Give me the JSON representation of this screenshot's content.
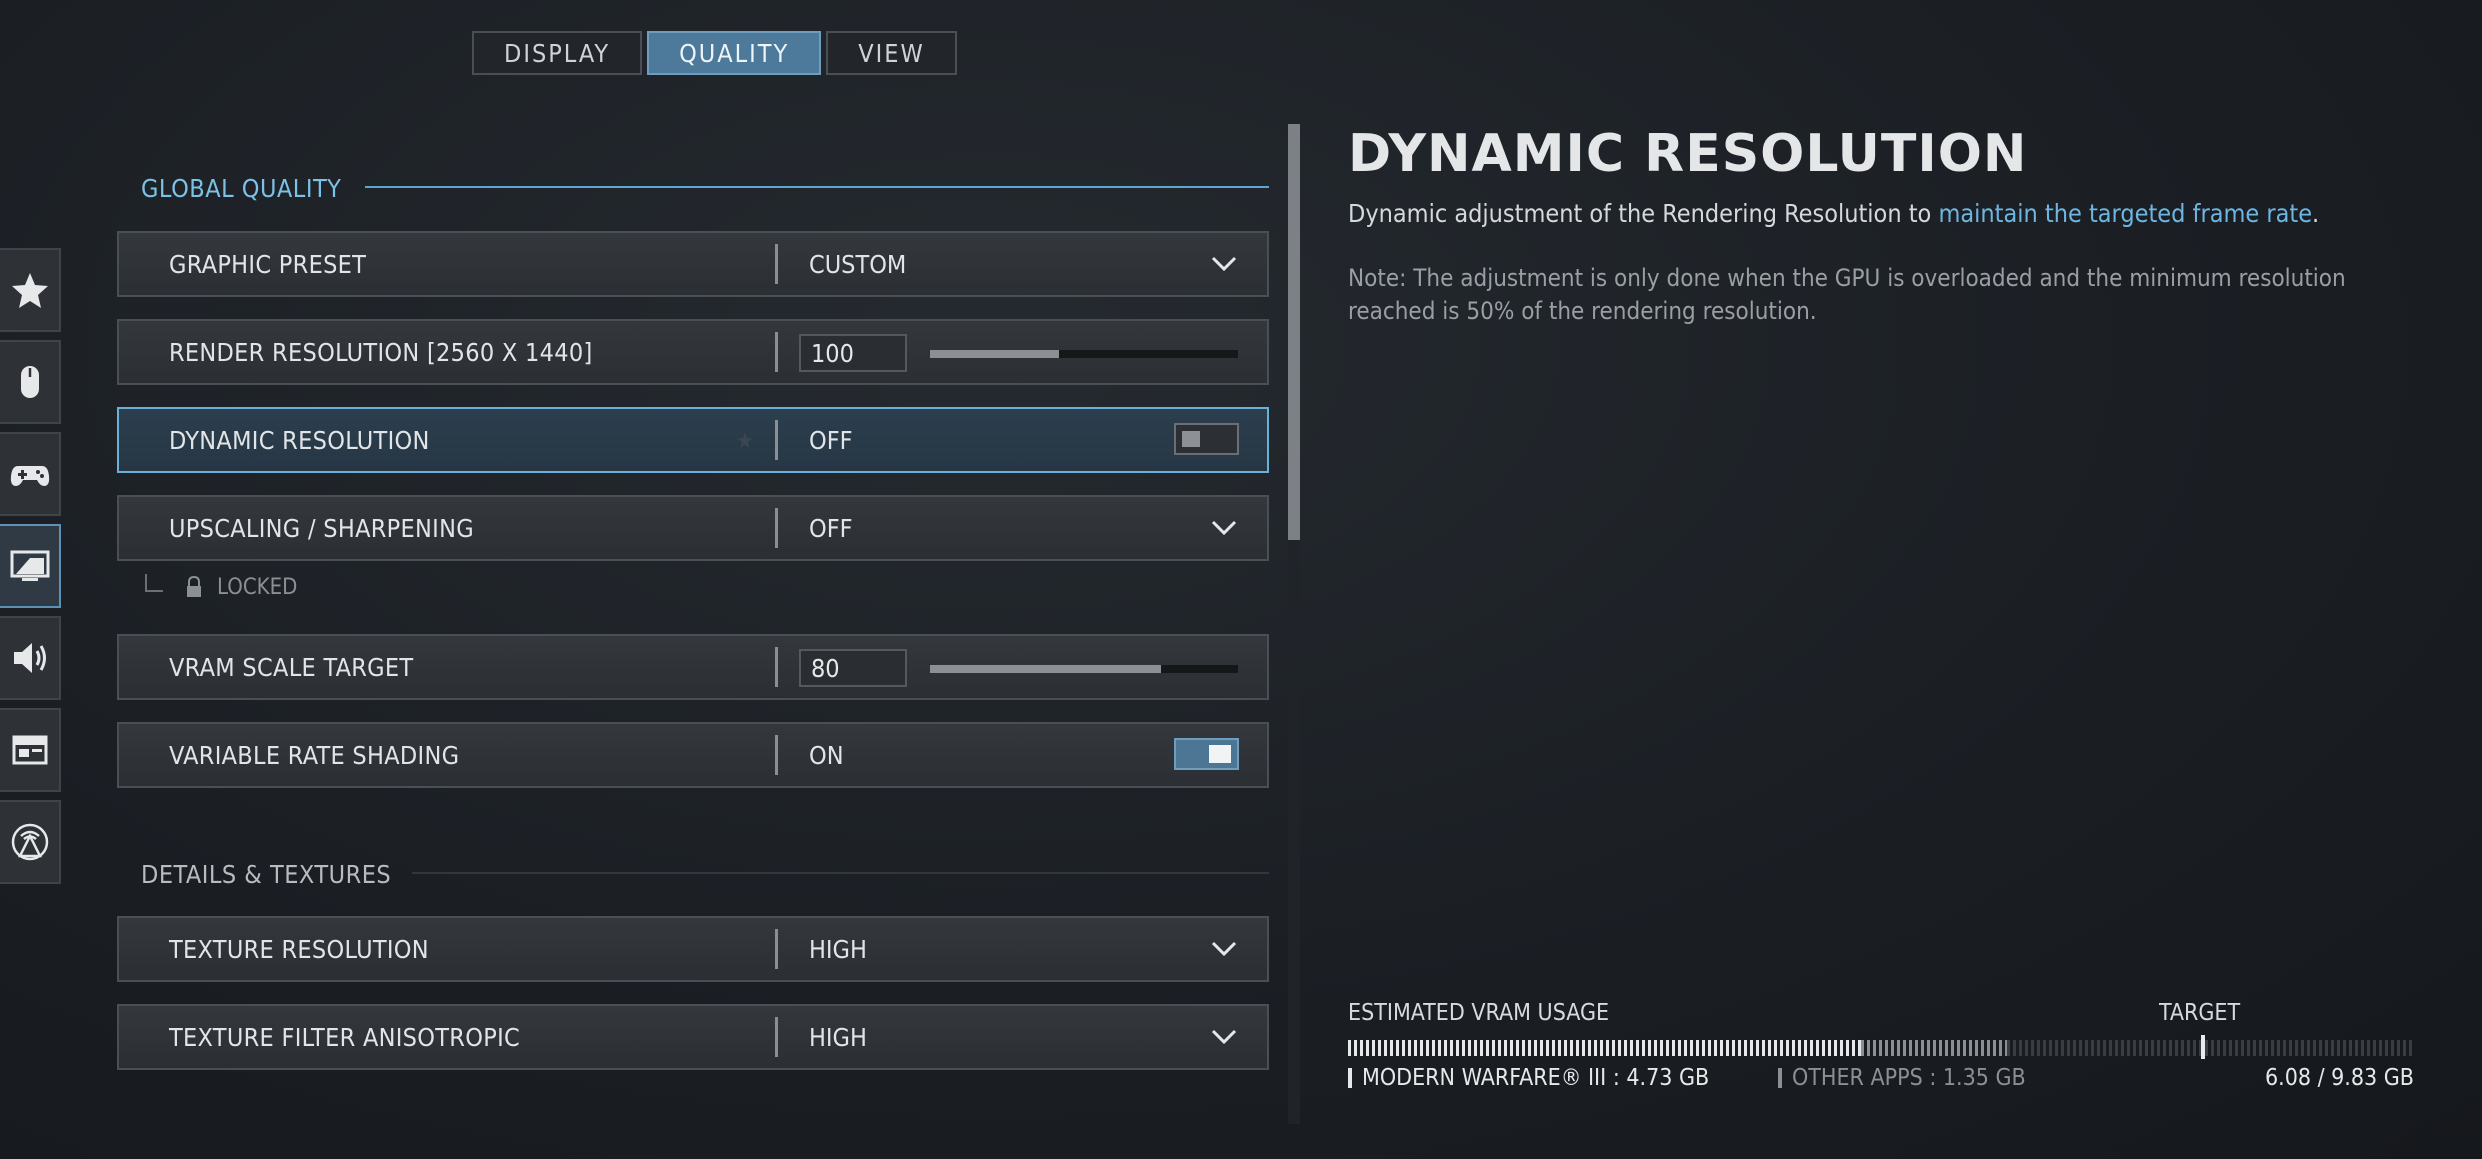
{
  "tabs": [
    {
      "label": "DISPLAY",
      "active": false
    },
    {
      "label": "QUALITY",
      "active": true
    },
    {
      "label": "VIEW",
      "active": false
    }
  ],
  "rail": [
    {
      "icon": "star-icon",
      "active": false
    },
    {
      "icon": "mouse-icon",
      "active": false
    },
    {
      "icon": "controller-icon",
      "active": false
    },
    {
      "icon": "graphics-icon",
      "active": true
    },
    {
      "icon": "audio-icon",
      "active": false
    },
    {
      "icon": "interface-icon",
      "active": false
    },
    {
      "icon": "network-icon",
      "active": false
    }
  ],
  "sections": {
    "global": "GLOBAL QUALITY",
    "details": "DETAILS & TEXTURES"
  },
  "rows": {
    "graphic_preset": {
      "label": "GRAPHIC PRESET",
      "value": "CUSTOM"
    },
    "render_resolution": {
      "label": "RENDER RESOLUTION [2560 X 1440]",
      "value": "100",
      "level": 0.42
    },
    "dynamic_resolution": {
      "label": "DYNAMIC RESOLUTION",
      "value": "OFF",
      "toggle": false
    },
    "upscaling": {
      "label": "UPSCALING / SHARPENING",
      "value": "OFF",
      "sub_label": "LOCKED"
    },
    "vram_scale": {
      "label": "VRAM SCALE TARGET",
      "value": "80",
      "level": 0.75
    },
    "vrs": {
      "label": "VARIABLE RATE SHADING",
      "value": "ON",
      "toggle": true
    },
    "texture_resolution": {
      "label": "TEXTURE RESOLUTION",
      "value": "HIGH"
    },
    "texture_filter": {
      "label": "TEXTURE FILTER ANISOTROPIC",
      "value": "HIGH"
    }
  },
  "detail": {
    "title": "DYNAMIC RESOLUTION",
    "desc_prefix": "Dynamic adjustment of the Rendering Resolution to ",
    "desc_link": "maintain the targeted frame rate",
    "desc_suffix": ".",
    "note": "Note: The adjustment is only done when the GPU is overloaded and the minimum resolution reached is 50% of the rendering resolution."
  },
  "vram": {
    "label": "ESTIMATED VRAM USAGE",
    "target_label": "TARGET",
    "game_label": "MODERN WARFARE® III : 4.73 GB",
    "other_label": "OTHER APPS : 1.35 GB",
    "total": "6.08 / 9.83 GB",
    "game_gb": 4.73,
    "other_gb": 1.35,
    "total_gb": 9.83,
    "target_fraction": 0.8,
    "colors": {
      "game": "#e6e8ea",
      "other": "#8b9095",
      "free": "#3a3e43"
    }
  }
}
